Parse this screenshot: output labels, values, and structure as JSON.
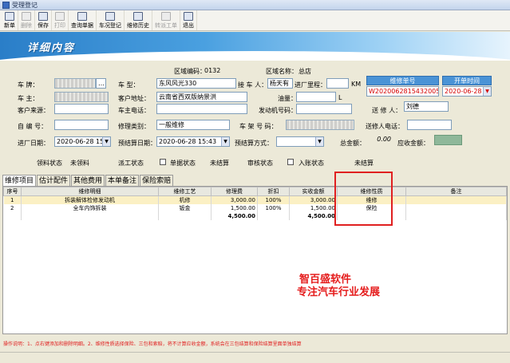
{
  "window": {
    "title": "受理登记"
  },
  "toolbar": {
    "new": "新单",
    "delete": "删除",
    "save": "保存",
    "print": "打印",
    "query": "查询单据",
    "supp": "车况登记",
    "history": "维修历史",
    "transfer": "转派工单",
    "exit": "退出"
  },
  "banner": {
    "title": "详细内容"
  },
  "form": {
    "zone_code_label": "区域编码：",
    "zone_code": "0132",
    "zone_name_label": "区域名称：",
    "zone_name": "总店",
    "plate_label": "车    牌：",
    "model_label": "车    型：",
    "model": "东风风光330",
    "receiver_label": "接 车 人：",
    "receiver": "杨天有",
    "mileage_label": "进厂里程：",
    "mileage_unit": "KM",
    "repair_no_label": "维修单号",
    "in_time_label": "开单时间",
    "repair_no": "W202006281543200530",
    "in_date": "2020-06-28",
    "owner_label": "车    主：",
    "address_label": "客户地址：",
    "address": "云南省西双版纳景洪",
    "fuel_label": "油量：",
    "fuel_unit": "L",
    "source_label": "客户来源：",
    "phone_label": "车主电话：",
    "engine_label": "发动机号码：",
    "repairer_label": "送 修 人：",
    "repairer": "刘德",
    "number_label": "自 编 号：",
    "repair_type_label": "修理类别：",
    "repair_type": "一般维修",
    "frame_label": "车 架 号 码：",
    "repairer_phone_label": "送修人电话：",
    "in_day_label": "进厂日期：",
    "in_day": "2020-06-28 15:4",
    "estimate_label": "预结算日期：",
    "estimate": "2020-06-28 15:43",
    "pay_label": "预结算方式：",
    "total_label": "总金额：",
    "total": "0.00",
    "paid_label": "应收金额："
  },
  "status": {
    "parts_label": "领料状态",
    "parts": "未领料",
    "dispatch_label": "派工状态",
    "check_label": "单据状态",
    "check": "未结算",
    "audit_label": "审核状态",
    "account_label": "入账状态",
    "account": "未结算"
  },
  "tabs": [
    "维修项目",
    "估计配件",
    "其他费用",
    "本单备注",
    "保险索赔"
  ],
  "table": {
    "headers": [
      "序号",
      "维修明细",
      "维修工艺",
      "修理费",
      "折扣",
      "实收金额",
      "维修性质",
      "备注"
    ],
    "rows": [
      [
        "1",
        "拆装解体检修发动机",
        "机修",
        "3,000.00",
        "100%",
        "3,000.00",
        "维修",
        ""
      ],
      [
        "2",
        "全车内饰拆装",
        "钣金",
        "1,500.00",
        "100%",
        "1,500.00",
        "保险",
        ""
      ]
    ],
    "total_fee": "4,500.00",
    "total_paid": "4,500.00"
  },
  "promo": {
    "line1": "智百盛软件",
    "line2": "专注汽车行业发展"
  },
  "footer": {
    "text": "操作说明：1、点右键添加和删除明细。2、维修性质选择保险、三包和索赔，将不计算应收金额，系统会在三包结算和保险结算里面单独结算"
  }
}
